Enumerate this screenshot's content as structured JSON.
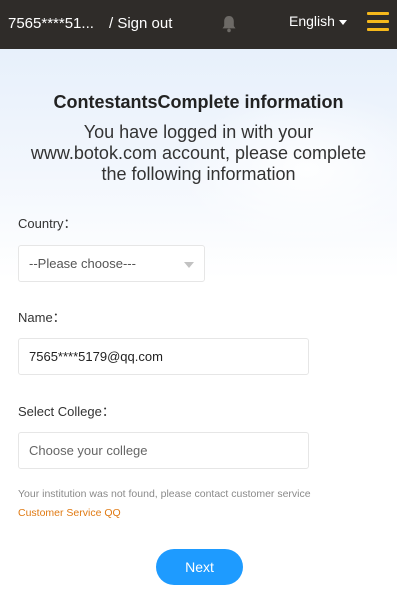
{
  "header": {
    "username": "7565****51...",
    "signout_label": "/ Sign out",
    "language_label": "English",
    "bell_icon": "bell-icon",
    "menu_icon": "hamburger-menu-icon",
    "menu_color": "#f5b81b"
  },
  "page": {
    "title": "ContestantsComplete information",
    "subtitle": "You have logged in with your www.botok.com account, please complete the following information"
  },
  "form": {
    "country_label": "Country：",
    "country_value": "--Please choose---",
    "name_label": "Name：",
    "name_value": "7565****5179@qq.com",
    "college_label": "Select College：",
    "college_placeholder": "Choose your college",
    "hint_text": "Your institution was not found, please contact customer service",
    "service_link": "Customer Service QQ",
    "next_label": "Next"
  },
  "colors": {
    "topbar": "#2f2c29",
    "accent_button": "#1e9bff",
    "link": "#e07a13"
  }
}
